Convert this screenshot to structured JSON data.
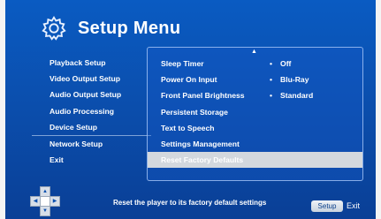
{
  "header": {
    "title": "Setup Menu",
    "icon": "gear-icon"
  },
  "left_menu": {
    "items": [
      {
        "label": "Playback Setup"
      },
      {
        "label": "Video Output Setup"
      },
      {
        "label": "Audio Output Setup"
      },
      {
        "label": "Audio Processing"
      },
      {
        "label": "Device Setup"
      },
      {
        "label": "Network Setup"
      },
      {
        "label": "Exit"
      }
    ]
  },
  "settings": {
    "items": [
      {
        "label": "Sleep Timer",
        "value": "Off"
      },
      {
        "label": "Power On Input",
        "value": "Blu-Ray"
      },
      {
        "label": "Front Panel Brightness",
        "value": "Standard"
      },
      {
        "label": "Persistent Storage"
      },
      {
        "label": "Text to Speech"
      },
      {
        "label": "Settings Management"
      },
      {
        "label": "Reset Factory Defaults",
        "selected": true
      }
    ]
  },
  "footer": {
    "help_text": "Reset the player to its factory default settings",
    "setup_button": "Setup",
    "exit_label": "Exit"
  },
  "colors": {
    "background": "#0b4fae",
    "highlight": "#d3d8de",
    "text": "#ffffff"
  }
}
